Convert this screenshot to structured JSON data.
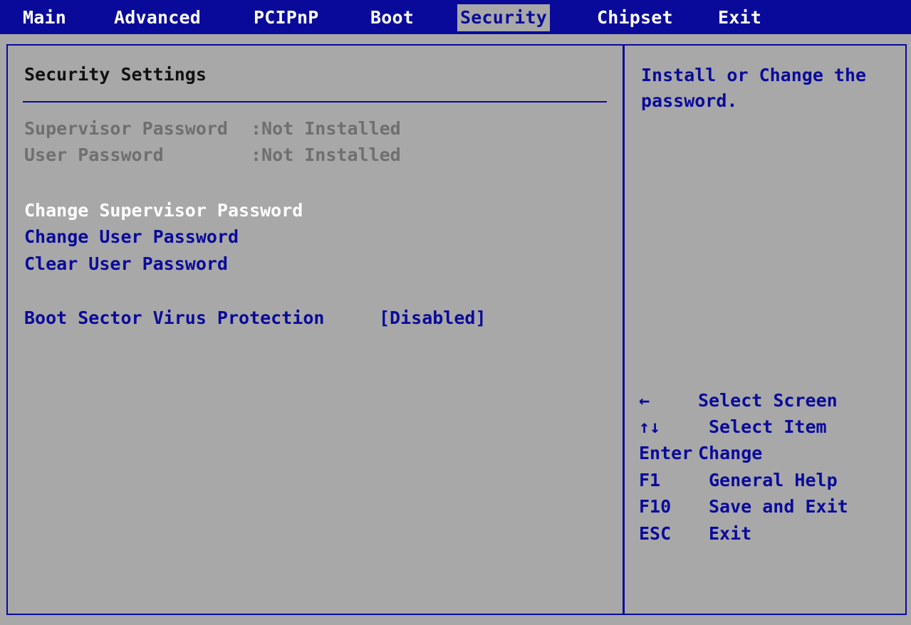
{
  "menu": {
    "tabs": [
      {
        "label": "Main"
      },
      {
        "label": "Advanced"
      },
      {
        "label": "PCIPnP"
      },
      {
        "label": "Boot"
      },
      {
        "label": "Security"
      },
      {
        "label": "Chipset"
      },
      {
        "label": "Exit"
      }
    ],
    "active_tab": "Security"
  },
  "main": {
    "heading": "Security Settings",
    "supervisor_password": {
      "label": "Supervisor Password",
      "value": ":Not Installed"
    },
    "user_password": {
      "label": "User Password",
      "value": ":Not Installed"
    },
    "actions": [
      {
        "label": "Change Supervisor Password"
      },
      {
        "label": "Change User Password"
      },
      {
        "label": "Clear User Password"
      }
    ],
    "boot_sector": {
      "label": "Boot Sector Virus Protection",
      "value": "[Disabled]"
    }
  },
  "help": {
    "text": "Install or Change the password."
  },
  "legend": [
    {
      "key": "←",
      "desc": "Select Screen"
    },
    {
      "key": "↑↓",
      "desc": "Select Item"
    },
    {
      "key": "Enter",
      "desc": "Change"
    },
    {
      "key": "F1",
      "desc": "General Help"
    },
    {
      "key": "F10",
      "desc": "Save and Exit"
    },
    {
      "key": "ESC",
      "desc": "Exit"
    }
  ],
  "colors": {
    "background": "#a8a8a8",
    "accent": "#0a0a9a",
    "selected_text": "#ffffff",
    "disabled_text": "#6f6f6f"
  }
}
